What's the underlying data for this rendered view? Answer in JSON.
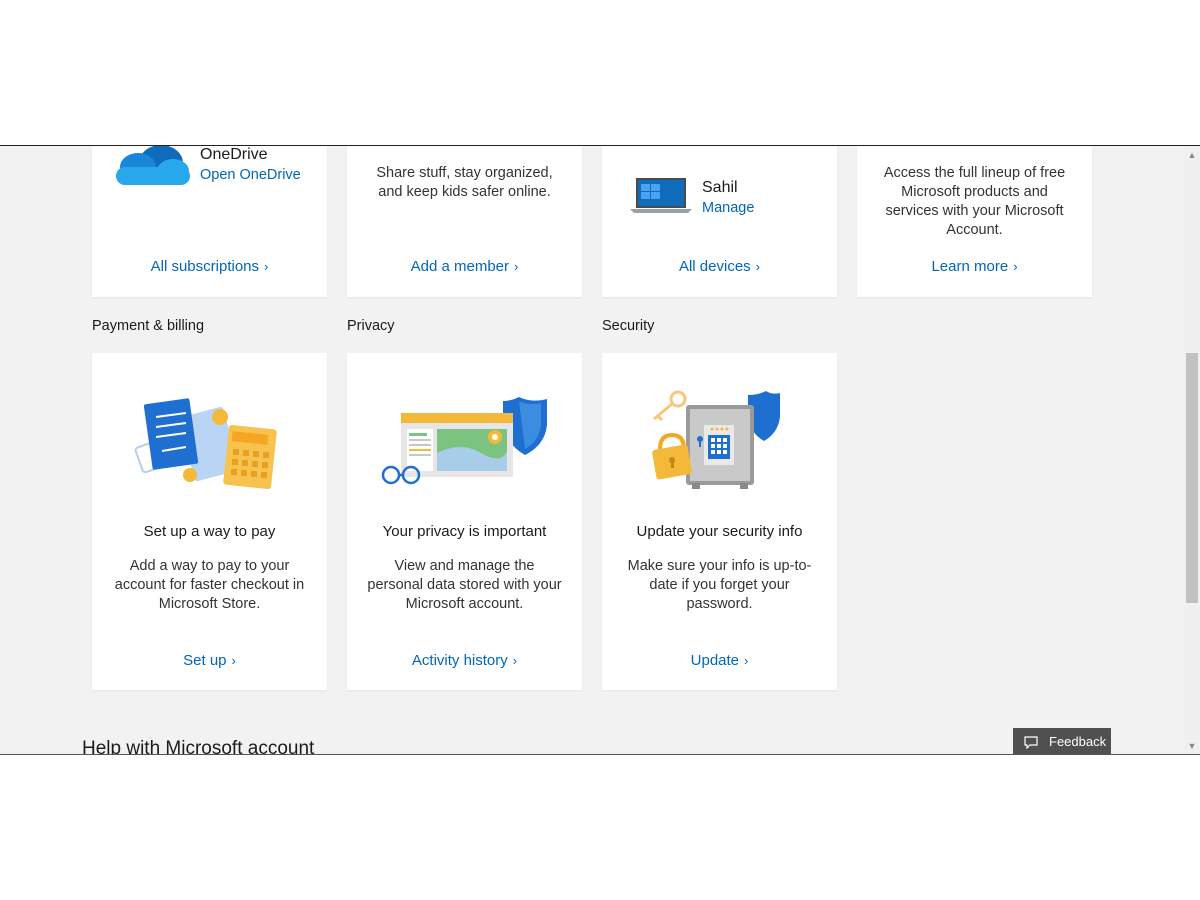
{
  "top_cards": {
    "subscriptions": {
      "product": "OneDrive",
      "open_link": "Open OneDrive",
      "footer_link": "All subscriptions"
    },
    "family": {
      "description": "Share stuff, stay organized, and keep kids safer online.",
      "footer_link": "Add a member"
    },
    "devices": {
      "device_name": "Sahil",
      "manage_link": "Manage",
      "footer_link": "All devices"
    },
    "rewards": {
      "description": "Access the full lineup of free Microsoft products and services with your Microsoft Account.",
      "footer_link": "Learn more"
    }
  },
  "sections": [
    {
      "heading": "Payment & billing",
      "title": "Set up a way to pay",
      "description": "Add a way to pay to your account for faster checkout in Microsoft Store.",
      "link": "Set up"
    },
    {
      "heading": "Privacy",
      "title": "Your privacy is important",
      "description": "View and manage the personal data stored with your Microsoft account.",
      "link": "Activity history"
    },
    {
      "heading": "Security",
      "title": "Update your security info",
      "description": "Make sure your info is up-to-date if you forget your password.",
      "link": "Update"
    }
  ],
  "help_heading": "Help with Microsoft account",
  "feedback_label": "Feedback",
  "colors": {
    "link": "#0067b8",
    "background": "#f2f2f2",
    "card": "#ffffff",
    "feedback_bg": "#505050"
  }
}
